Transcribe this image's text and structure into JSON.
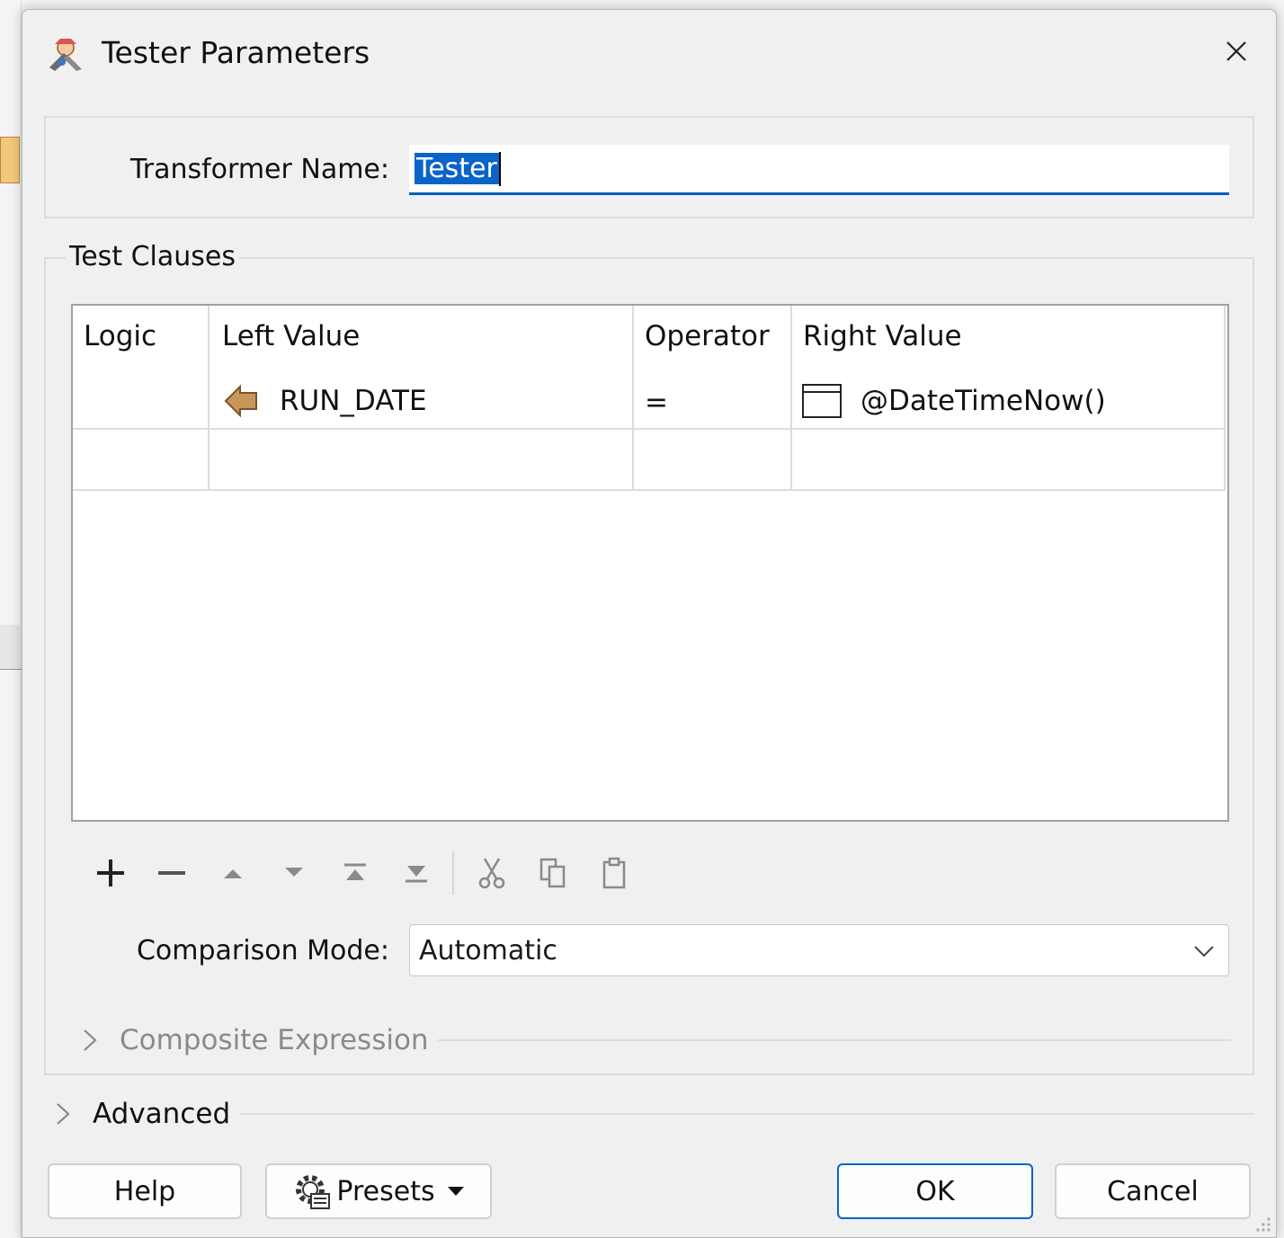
{
  "window": {
    "title": "Tester Parameters"
  },
  "transformer": {
    "label": "Transformer Name:",
    "value": "Tester"
  },
  "test_clauses": {
    "group_title": "Test Clauses",
    "columns": [
      "Logic",
      "Left Value",
      "Operator",
      "Right Value"
    ],
    "rows": [
      {
        "logic": "",
        "left_value": "RUN_DATE",
        "left_icon": "attribute-arrow-icon",
        "operator": "=",
        "right_value": "@DateTimeNow()",
        "right_icon": "text-editor-icon"
      }
    ]
  },
  "toolbar": {
    "items": [
      "add-icon",
      "remove-icon",
      "move-up-icon",
      "move-down-icon",
      "move-to-top-icon",
      "move-to-bottom-icon",
      "cut-icon",
      "copy-icon",
      "paste-icon"
    ]
  },
  "comparison": {
    "label": "Comparison Mode:",
    "value": "Automatic"
  },
  "composite": {
    "label": "Composite Expression"
  },
  "advanced": {
    "label": "Advanced"
  },
  "buttons": {
    "help": "Help",
    "presets": "Presets",
    "ok": "OK",
    "cancel": "Cancel"
  },
  "colors": {
    "accent": "#0a63c8",
    "selection": "#0a63c8",
    "attribute_icon": "#c9965a"
  }
}
